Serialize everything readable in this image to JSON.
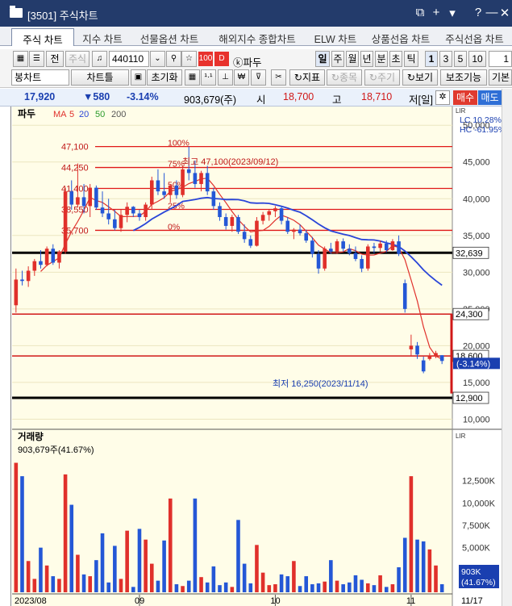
{
  "window": {
    "title": "[3501] 주식차트",
    "icons": [
      "restore-icon",
      "plus-icon",
      "chevron-down-icon",
      "help-icon",
      "minimize-icon",
      "close-icon"
    ],
    "icon_glyphs": [
      "⧉",
      "+",
      "▾",
      "?",
      "—",
      "✕"
    ]
  },
  "tabs": [
    "주식 차트",
    "지수 차트",
    "선물옵션 차트",
    "해외지수 종합차트",
    "ELW 차트",
    "상품선옵 차트",
    "주식선옵 차트"
  ],
  "toolbar1": {
    "market_label": "전",
    "stock_type": "주식",
    "code": "440110",
    "badge_100": "100",
    "badge_d": "D",
    "stock_name": "ⓚ파두",
    "periods": [
      "일",
      "주",
      "월",
      "년",
      "분",
      "초",
      "틱"
    ],
    "intervals": [
      "1",
      "3",
      "5",
      "10"
    ],
    "interval_value": "1"
  },
  "toolbar2": {
    "chart_type": "봉차트",
    "chart_frame": "차트틀",
    "reset": "초기화",
    "indicator": "지표",
    "stock": "종목",
    "cycle": "주기",
    "view": "보기",
    "aux": "보조기능",
    "basic": "기본"
  },
  "quote": {
    "price": "17,920",
    "change": "▼580",
    "change_pct": "-3.14%",
    "volume": "903,679(주)",
    "open_label": "시",
    "open": "18,700",
    "high_label": "고",
    "high": "18,710",
    "period_label": "저[일]",
    "buy": "매수",
    "sell": "매도"
  },
  "chart": {
    "stock_label": "파두",
    "ma_prefix": "MA",
    "ma_values": [
      "5",
      "20",
      "50",
      "200"
    ],
    "ma_colors": [
      "#e0302b",
      "#2a45d8",
      "#2a9a2a",
      "#7a7a7a"
    ],
    "lc_label": "LC  10.28%",
    "hc_label": "HC -61.95%",
    "high_annotation": "최고 47,100(2023/09/12)",
    "low_annotation": "최저 16,250(2023/11/14)",
    "fib_levels": [
      {
        "price": "47,100",
        "pct": "100%"
      },
      {
        "price": "44,250",
        "pct": "75%"
      },
      {
        "price": "41,400",
        "pct": "50%"
      },
      {
        "price": "38,550",
        "pct": "25%"
      },
      {
        "price": "35,700",
        "pct": "0%"
      }
    ],
    "hline_labels": [
      "32,639",
      "24,300",
      "18,600",
      "12,900"
    ],
    "current_label": "17,920",
    "current_pct": "(-3.14%)",
    "y_ticks": [
      "50,000",
      "45,000",
      "40,000",
      "35,000",
      "30,000",
      "25,000",
      "20,000",
      "15,000",
      "10,000"
    ],
    "volume_title": "거래량",
    "volume_value": "903,679주(41.67%)",
    "vol_ticks": [
      "12,500K",
      "10,000K",
      "7,500K",
      "5,000K",
      "2,500K"
    ],
    "vol_badge": [
      "903K",
      "(41.67%)"
    ],
    "x_labels": [
      "2023/08",
      "09",
      "10",
      "11",
      "11/17"
    ],
    "scale_marks": [
      "LIR",
      "LIR"
    ]
  },
  "chart_data": {
    "type": "candlestick",
    "y_range": [
      10000,
      50000
    ],
    "candles": [
      [
        25500,
        30500,
        24500,
        29000
      ],
      [
        29000,
        30200,
        28200,
        28800
      ],
      [
        28800,
        30800,
        28000,
        30200
      ],
      [
        30200,
        31800,
        29500,
        31500
      ],
      [
        31500,
        33000,
        30500,
        31000
      ],
      [
        31000,
        33500,
        30800,
        33200
      ],
      [
        33200,
        33800,
        31000,
        31300
      ],
      [
        31300,
        33000,
        30500,
        32800
      ],
      [
        32800,
        41500,
        32500,
        41000
      ],
      [
        41000,
        42500,
        38500,
        39200
      ],
      [
        39200,
        44800,
        38800,
        40200
      ],
      [
        40200,
        42000,
        38000,
        39000
      ],
      [
        39000,
        42000,
        37500,
        41500
      ],
      [
        41500,
        41800,
        38500,
        38800
      ],
      [
        38800,
        41000,
        37500,
        38000
      ],
      [
        38000,
        40000,
        36500,
        37200
      ],
      [
        37200,
        38500,
        35700,
        36000
      ],
      [
        36000,
        38500,
        35500,
        37800
      ],
      [
        37800,
        39500,
        36800,
        38900
      ],
      [
        38900,
        39000,
        37500,
        38000
      ],
      [
        38000,
        38500,
        37000,
        37500
      ],
      [
        37500,
        39500,
        37000,
        39200
      ],
      [
        39200,
        43000,
        38500,
        42500
      ],
      [
        42500,
        44000,
        40500,
        41000
      ],
      [
        41000,
        43500,
        40000,
        40500
      ],
      [
        40500,
        42000,
        39500,
        41800
      ],
      [
        41800,
        42500,
        40000,
        40500
      ],
      [
        40500,
        44500,
        40200,
        44000
      ],
      [
        44000,
        47100,
        42500,
        43500
      ],
      [
        43500,
        45200,
        41500,
        42000
      ],
      [
        42000,
        43800,
        41000,
        43500
      ],
      [
        43500,
        44500,
        40500,
        41000
      ],
      [
        41000,
        41500,
        38500,
        39000
      ],
      [
        39000,
        39500,
        37000,
        37500
      ],
      [
        37500,
        38000,
        35800,
        36300
      ],
      [
        36300,
        37800,
        35500,
        37500
      ],
      [
        37500,
        37800,
        35200,
        35500
      ],
      [
        35500,
        36500,
        34000,
        34500
      ],
      [
        34500,
        35000,
        33300,
        33600
      ],
      [
        33600,
        37500,
        33500,
        37000
      ],
      [
        37000,
        38200,
        36500,
        37800
      ],
      [
        37800,
        38500,
        37000,
        38300
      ],
      [
        38300,
        39000,
        37500,
        38700
      ],
      [
        38700,
        39000,
        36500,
        37000
      ],
      [
        37000,
        37500,
        35200,
        35500
      ],
      [
        35500,
        36000,
        34500,
        35800
      ],
      [
        35800,
        36500,
        35000,
        35300
      ],
      [
        35300,
        35800,
        34000,
        34300
      ],
      [
        34300,
        34800,
        32000,
        32500
      ],
      [
        32500,
        33000,
        29800,
        30500
      ],
      [
        30500,
        33500,
        30200,
        33200
      ],
      [
        33200,
        34000,
        32500,
        32800
      ],
      [
        32800,
        34500,
        32500,
        34200
      ],
      [
        34200,
        34600,
        32800,
        33200
      ],
      [
        33200,
        33800,
        32300,
        32600
      ],
      [
        32600,
        33500,
        31500,
        31800
      ],
      [
        31800,
        32300,
        30000,
        30500
      ],
      [
        30500,
        33800,
        30200,
        33500
      ],
      [
        33500,
        34000,
        32600,
        33300
      ],
      [
        33300,
        34300,
        32800,
        33900
      ],
      [
        33900,
        34300,
        32700,
        33000
      ],
      [
        33000,
        34500,
        32900,
        34200
      ],
      [
        34200,
        35000,
        32200,
        32500
      ],
      [
        28500,
        29000,
        24500,
        25000
      ],
      [
        19500,
        21500,
        18500,
        20000
      ],
      [
        20000,
        20500,
        18200,
        18800
      ],
      [
        18000,
        18500,
        16250,
        16500
      ],
      [
        18200,
        19000,
        18000,
        18600
      ],
      [
        18600,
        19300,
        18300,
        19000
      ],
      [
        18700,
        18710,
        17500,
        17920
      ]
    ],
    "volume_k": [
      14500,
      13000,
      3500,
      1500,
      5000,
      3000,
      1800,
      1500,
      13200,
      9800,
      4200,
      2000,
      1800,
      3600,
      6600,
      1100,
      5200,
      1500,
      6900,
      600,
      7100,
      5900,
      3200,
      1300,
      5800,
      10500,
      900,
      700,
      1300,
      10500,
      1700,
      1100,
      2900,
      800,
      1100,
      600,
      8100,
      3200,
      1000,
      5300,
      2200,
      800,
      900,
      2000,
      1800,
      3500,
      700,
      1800,
      900,
      1000,
      1200,
      3600,
      1300,
      900,
      1100,
      1900,
      1400,
      1000,
      800,
      1900,
      600,
      900,
      2800,
      6100,
      13000,
      5900,
      5700,
      4800,
      3000,
      903
    ]
  }
}
